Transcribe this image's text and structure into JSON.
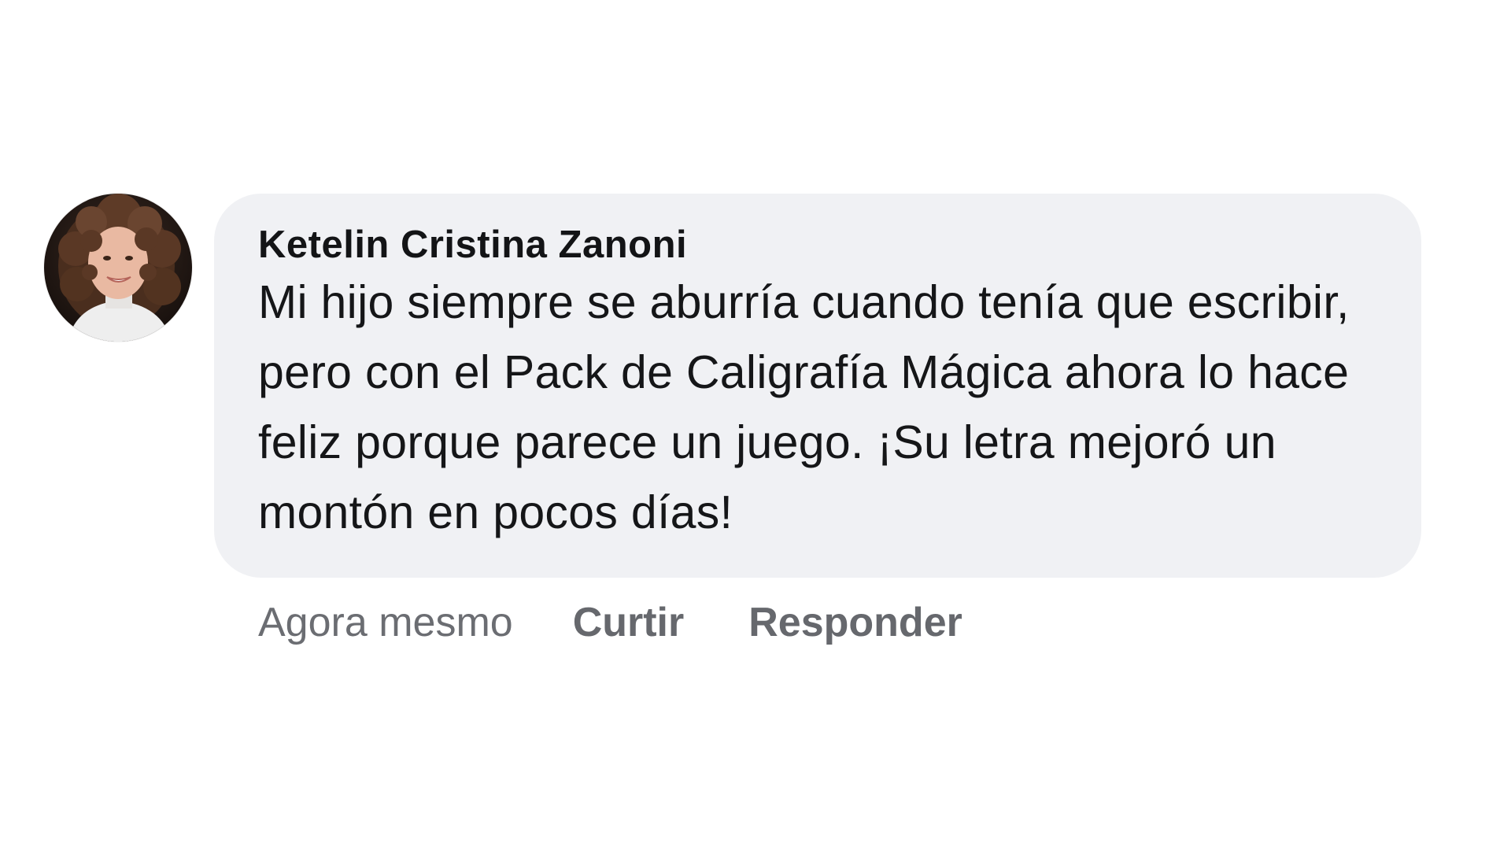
{
  "comment": {
    "author": "Ketelin Cristina Zanoni",
    "text": "Mi hijo siempre se aburría cuando tenía que escribir, pero con el Pack de Caligrafía Mágica ahora lo hace feliz porque parece un juego. ¡Su letra mejoró un montón en pocos días!",
    "timestamp": "Agora mesmo",
    "like_label": "Curtir",
    "reply_label": "Responder",
    "avatar_icon": "profile-photo"
  },
  "colors": {
    "bubble": "#f0f1f4",
    "author_text": "#131416",
    "body_text": "#151618",
    "meta_text": "#6b6d72"
  }
}
